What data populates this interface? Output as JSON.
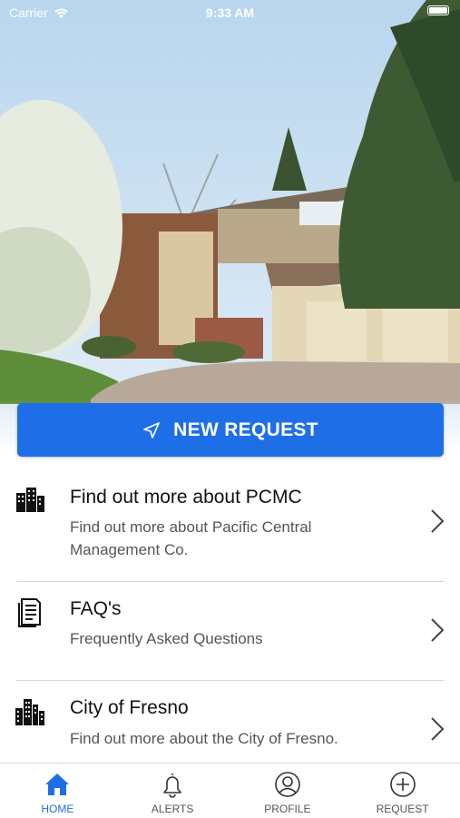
{
  "status_bar": {
    "carrier": "Carrier",
    "time": "9:33 AM"
  },
  "hero": {
    "image": "house-photo"
  },
  "new_request_button": {
    "label": "NEW REQUEST",
    "icon": "paper-plane-icon"
  },
  "list": [
    {
      "icon": "buildings-icon",
      "title": "Find out more about PCMC",
      "subtitle": "Find out more about Pacific Central Management Co."
    },
    {
      "icon": "document-icon",
      "title": "FAQ's",
      "subtitle": "Frequently Asked Questions"
    },
    {
      "icon": "city-icon",
      "title": "City of Fresno",
      "subtitle": "Find out more about the City of Fresno."
    }
  ],
  "tabbar": {
    "tabs": [
      {
        "label": "HOME",
        "icon": "home-icon",
        "active": true
      },
      {
        "label": "ALERTS",
        "icon": "bell-icon",
        "active": false
      },
      {
        "label": "PROFILE",
        "icon": "user-circle-icon",
        "active": false
      },
      {
        "label": "REQUEST",
        "icon": "plus-circle-icon",
        "active": false
      }
    ]
  },
  "colors": {
    "accent": "#1e6ee8",
    "text": "#111111",
    "subtext": "#555555",
    "divider": "#d7d7d7"
  }
}
